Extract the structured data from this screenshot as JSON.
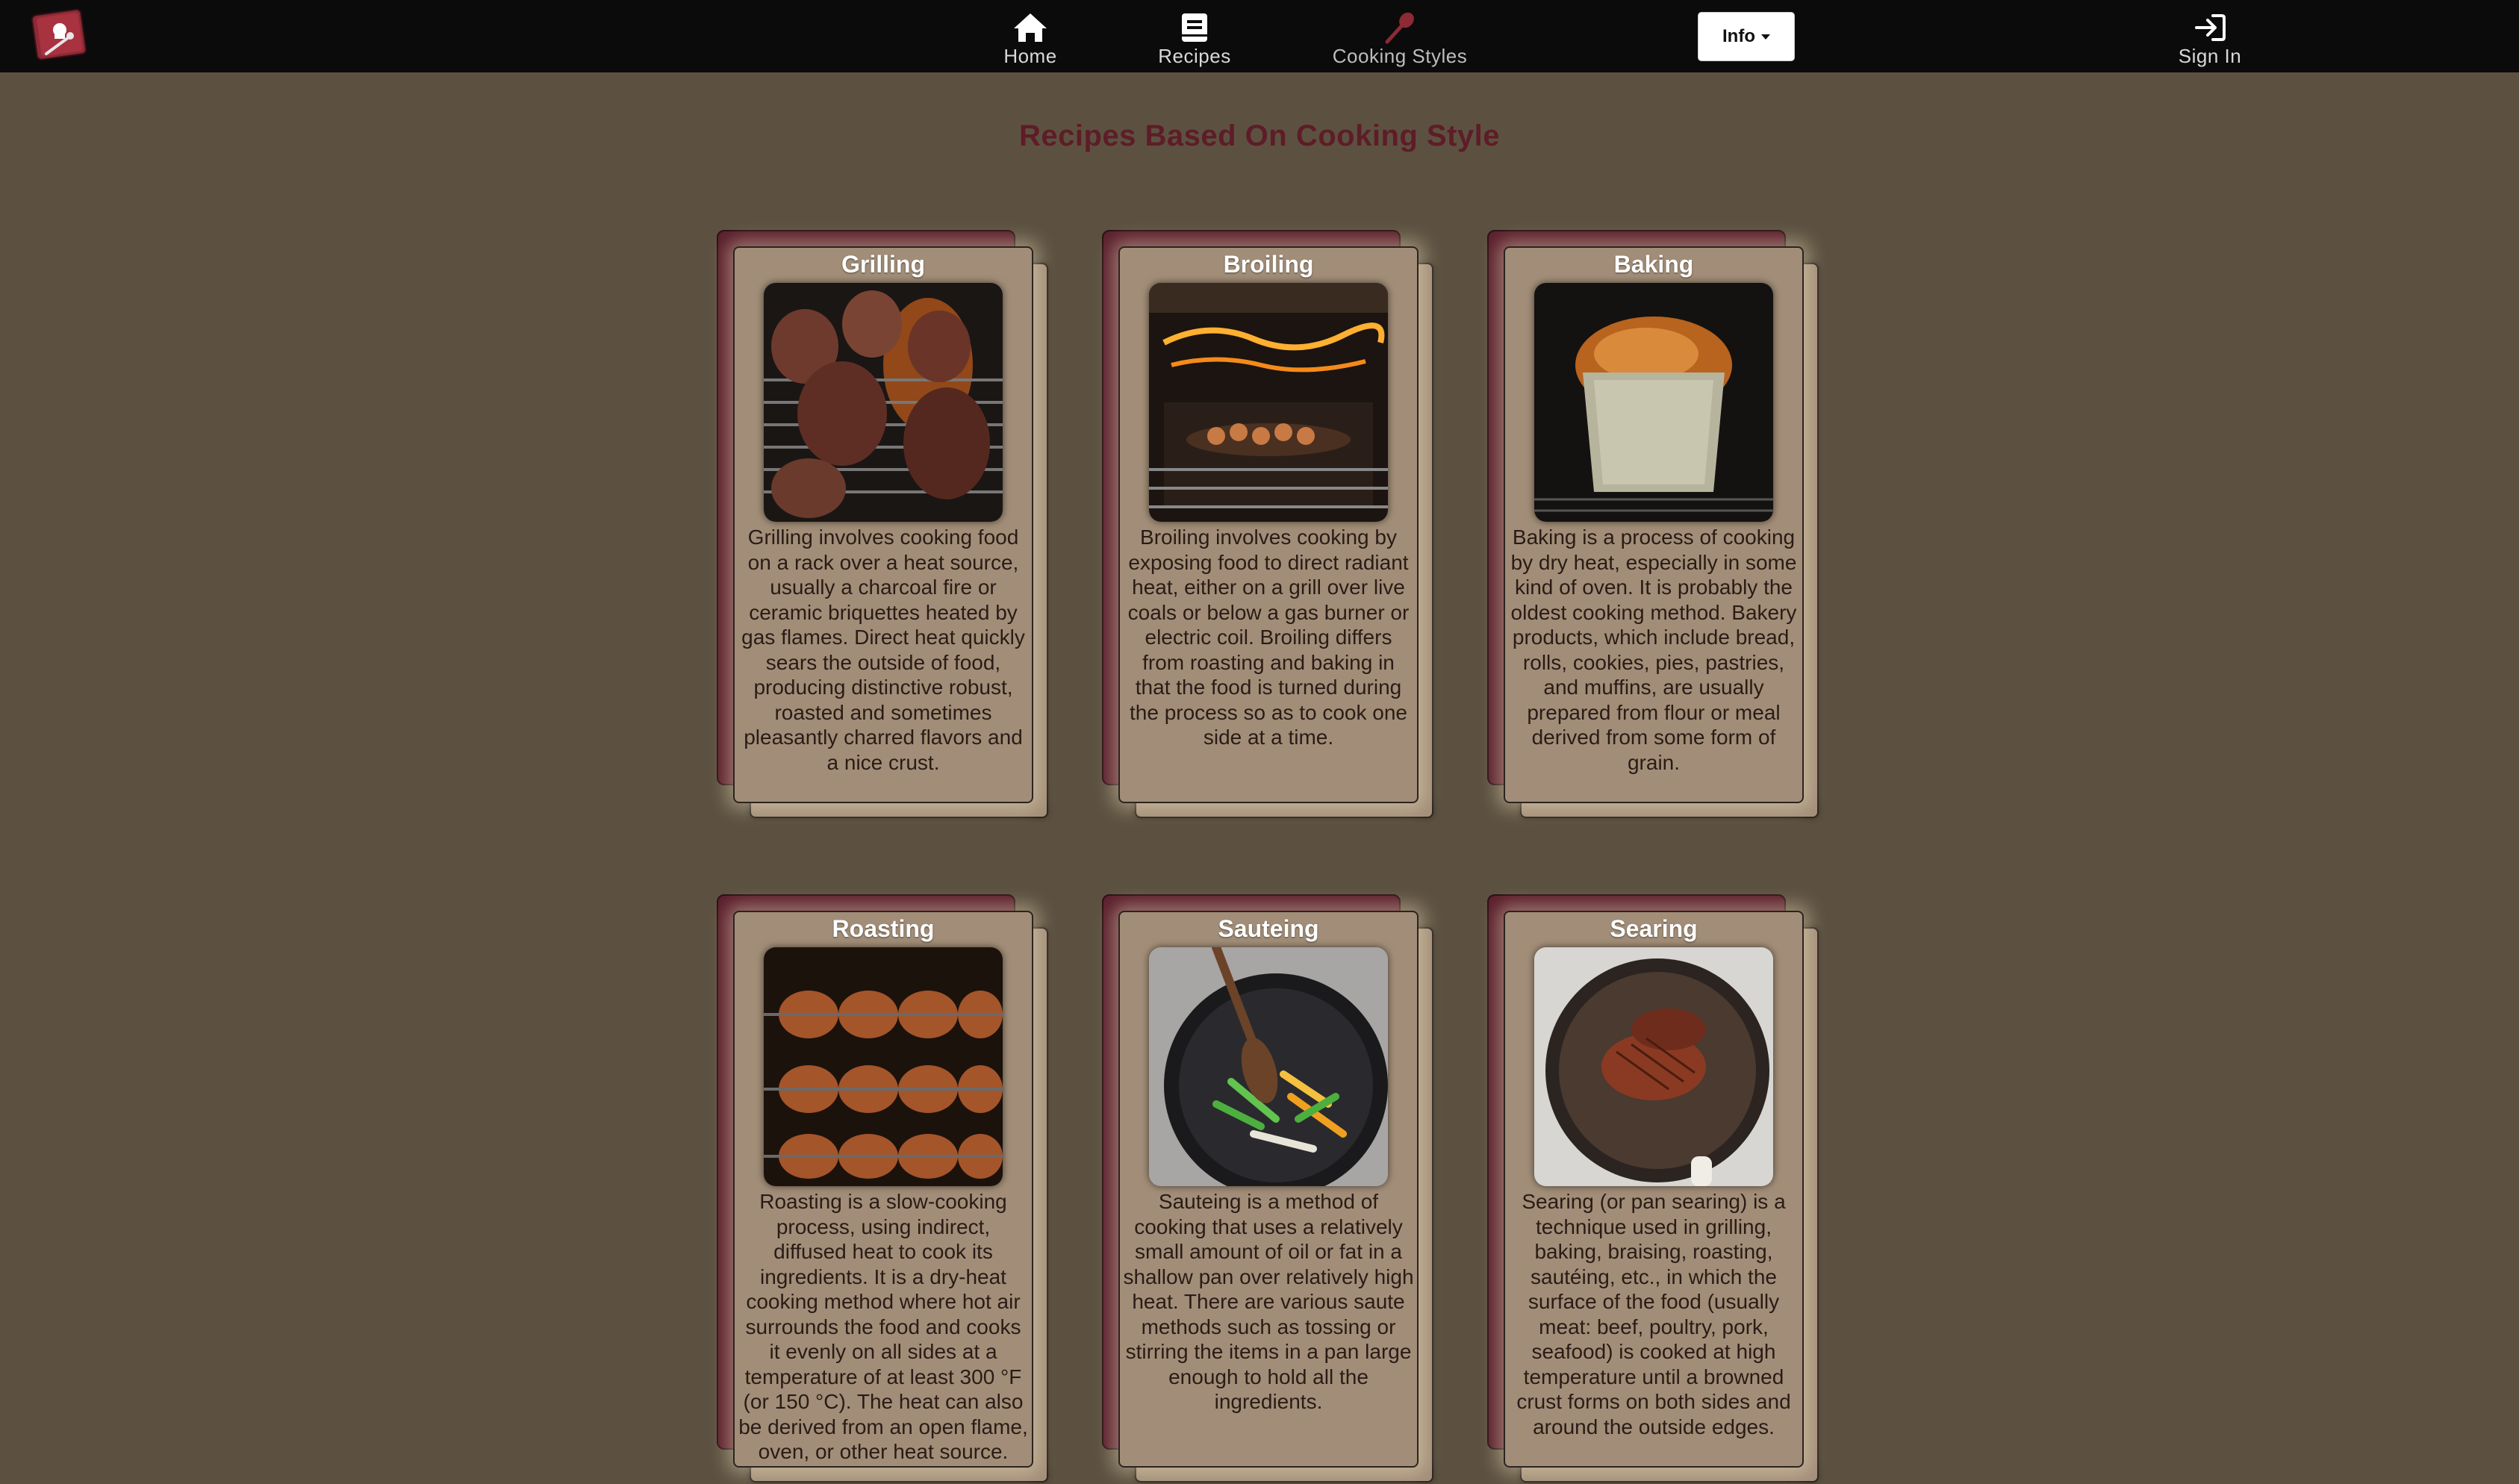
{
  "nav": {
    "brand": "brand-logo",
    "items": [
      {
        "label": "Home",
        "icon": "home-icon"
      },
      {
        "label": "Recipes",
        "icon": "book-icon"
      },
      {
        "label": "Cooking Styles",
        "icon": "spoon-icon"
      }
    ],
    "info_label": "Info",
    "signin_label": "Sign In"
  },
  "page": {
    "title": "Recipes Based On Cooking Style"
  },
  "colors": {
    "navbar": "#0c0b0b",
    "background": "#5c5140",
    "title": "#5e1c28",
    "card_tan": "#a28e78",
    "card_maroon": "#5a1f2c"
  },
  "cards": [
    {
      "title": "Grilling",
      "image": "grilled-meat-image",
      "description": "Grilling involves cooking food on a rack over a heat source, usually a charcoal fire or ceramic briquettes heated by gas flames. Direct heat quickly sears the outside of food, producing distinctive robust, roasted and sometimes pleasantly charred flavors and a nice crust."
    },
    {
      "title": "Broiling",
      "image": "oven-broiler-image",
      "description": "Broiling involves cooking by exposing food to direct radiant heat, either on a grill over live coals or below a gas burner or electric coil. Broiling differs from roasting and baking in that the food is turned during the process so as to cook one side at a time."
    },
    {
      "title": "Baking",
      "image": "bread-loaf-image",
      "description": "Baking is a process of cooking by dry heat, especially in some kind of oven. It is probably the oldest cooking method. Bakery products, which include bread, rolls, cookies, pies, pastries, and muffins, are usually prepared from flour or meal derived from some form of grain."
    },
    {
      "title": "Roasting",
      "image": "rotisserie-chicken-image",
      "description": "Roasting is a slow-cooking process, using indirect, diffused heat to cook its ingredients. It is a dry-heat cooking method where hot air surrounds the food and cooks it evenly on all sides at a temperature of at least 300 °F (or 150 °C). The heat can also be derived from an open flame, oven, or other heat source."
    },
    {
      "title": "Sauteing",
      "image": "saute-pan-image",
      "description": "Sauteing is a method of cooking that uses a relatively small amount of oil or fat in a shallow pan over relatively high heat. There are various saute methods such as tossing or stirring the items in a pan large enough to hold all the ingredients."
    },
    {
      "title": "Searing",
      "image": "seared-meat-image",
      "description": "Searing (or pan searing) is a technique used in grilling, baking, braising, roasting, sautéing, etc., in which the surface of the food (usually meat: beef, poultry, pork, seafood) is cooked at high temperature until a browned crust forms on both sides and around the outside edges."
    }
  ]
}
